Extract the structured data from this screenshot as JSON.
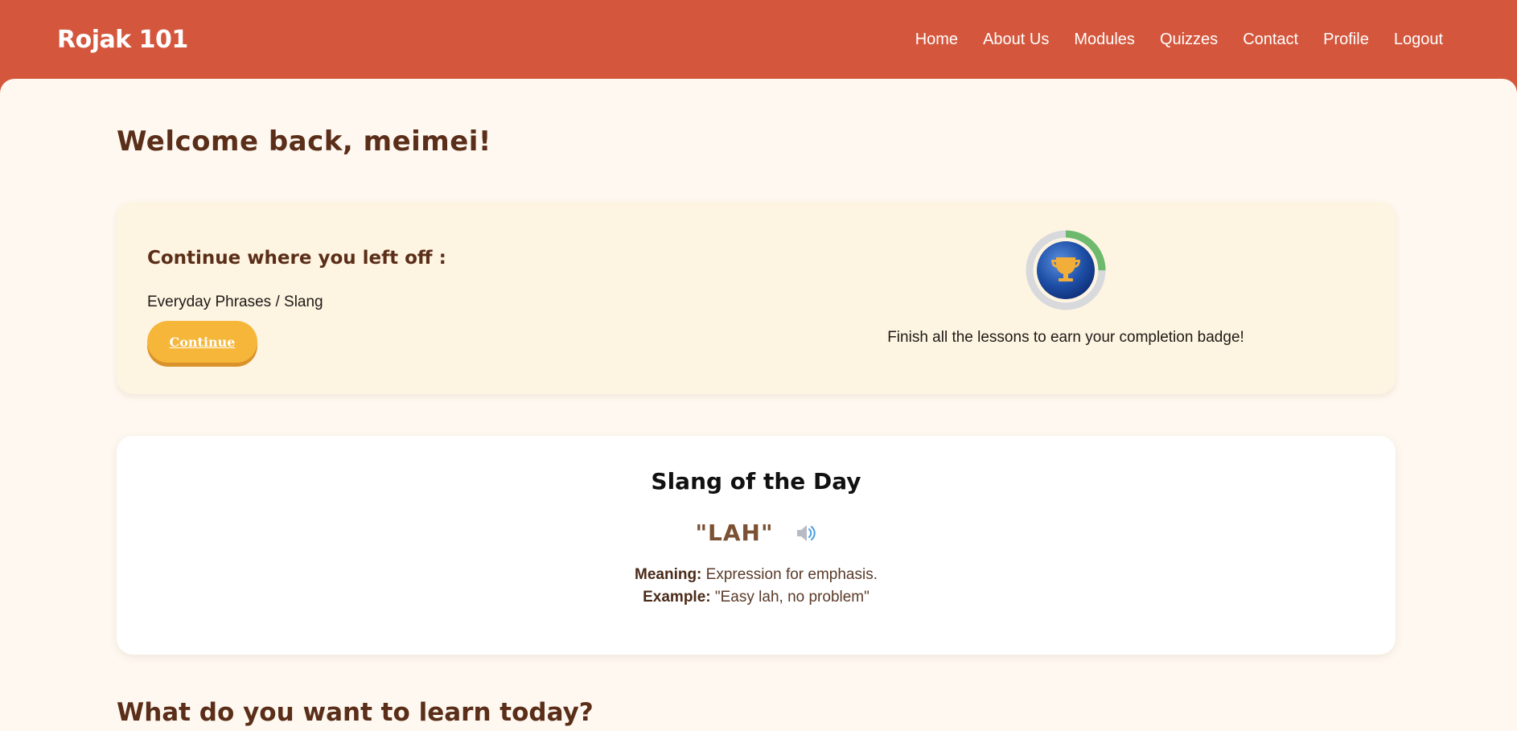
{
  "brand": "Rojak 101",
  "nav": [
    "Home",
    "About Us",
    "Modules",
    "Quizzes",
    "Contact",
    "Profile",
    "Logout"
  ],
  "welcome": "Welcome back, meimei!",
  "continue_card": {
    "title": "Continue where you left off :",
    "path": "Everyday Phrases / Slang",
    "button": "Continue",
    "badge_caption": "Finish all the lessons to earn your completion badge!",
    "badge_icon": "trophy-icon",
    "progress": 0.25
  },
  "slang_card": {
    "title": "Slang of the Day",
    "word": "\"LAH\"",
    "speaker_icon": "speaker-icon",
    "meaning_label": "Meaning:",
    "meaning": "Expression for emphasis.",
    "example_label": "Example:",
    "example": "\"Easy lah, no problem\""
  },
  "learn_heading": "What do you want to learn today?",
  "colors": {
    "header": "#d4573d",
    "background": "#fef8f0",
    "button": "#f6b63a",
    "progress": "#6db96d",
    "badge": "#1e4fa6"
  }
}
